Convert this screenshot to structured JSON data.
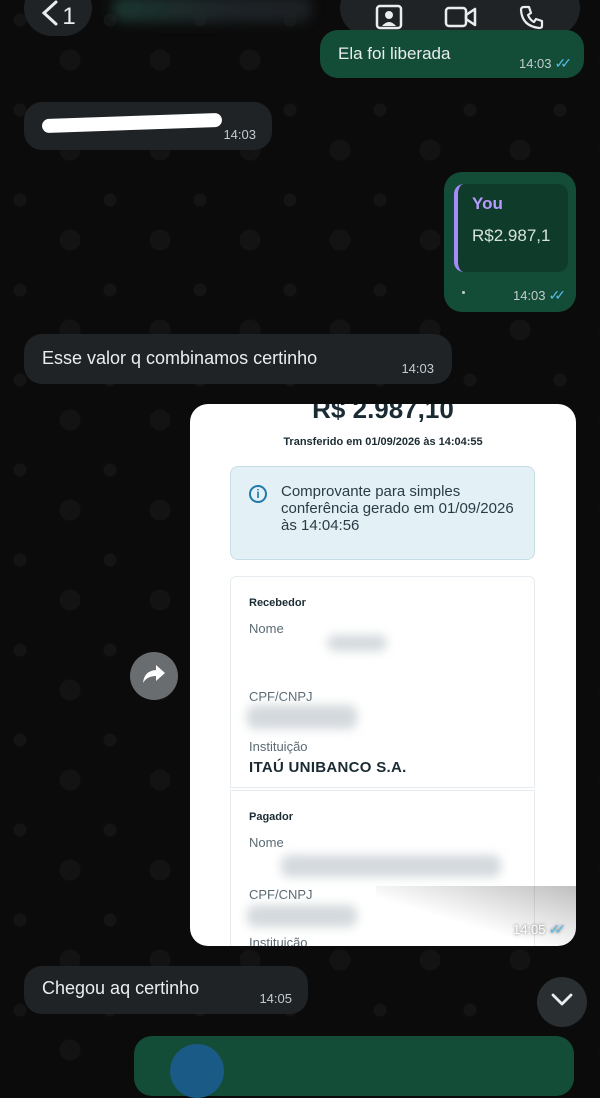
{
  "header": {
    "back_count": "1",
    "contact_name": "",
    "icons": [
      "profile-icon",
      "video-call-icon",
      "voice-call-icon"
    ]
  },
  "messages": [
    {
      "direction": "out",
      "text": "Ela foi liberada",
      "time": "14:03",
      "status": "read"
    },
    {
      "direction": "in",
      "text": "",
      "time": "14:03"
    },
    {
      "direction": "out",
      "reply_author": "You",
      "reply_text": "R$2.987,1",
      "time": "14:03",
      "status": "read"
    },
    {
      "direction": "in",
      "text": "Esse valor q combinamos certinho",
      "time": "14:03"
    },
    {
      "direction": "out",
      "type": "image",
      "time": "14:05",
      "status": "read",
      "receipt": {
        "amount": "R$ 2.987,10",
        "transfer_line": "Transferido em 01/09/2026 às 14:04:55",
        "info_text": "Comprovante para simples conferência gerado em 01/09/2026 às 14:04:56",
        "recipient_section": "Recebedor",
        "recipient_name_label": "Nome",
        "recipient_doc_label": "CPF/CNPJ",
        "recipient_inst_label": "Instituição",
        "recipient_inst_value": "ITAÚ UNIBANCO S.A.",
        "payer_section": "Pagador",
        "payer_name_label": "Nome",
        "payer_doc_label": "CPF/CNPJ",
        "payer_inst_label": "Instituição"
      }
    },
    {
      "direction": "in",
      "text": "Chegou aq certinho",
      "time": "14:05"
    }
  ],
  "ticks": "✓✓",
  "colors": {
    "outgoing_bubble": "#144d37",
    "incoming_bubble": "#1f2326",
    "read_ticks": "#53bdeb",
    "reply_author": "#b79cff"
  }
}
